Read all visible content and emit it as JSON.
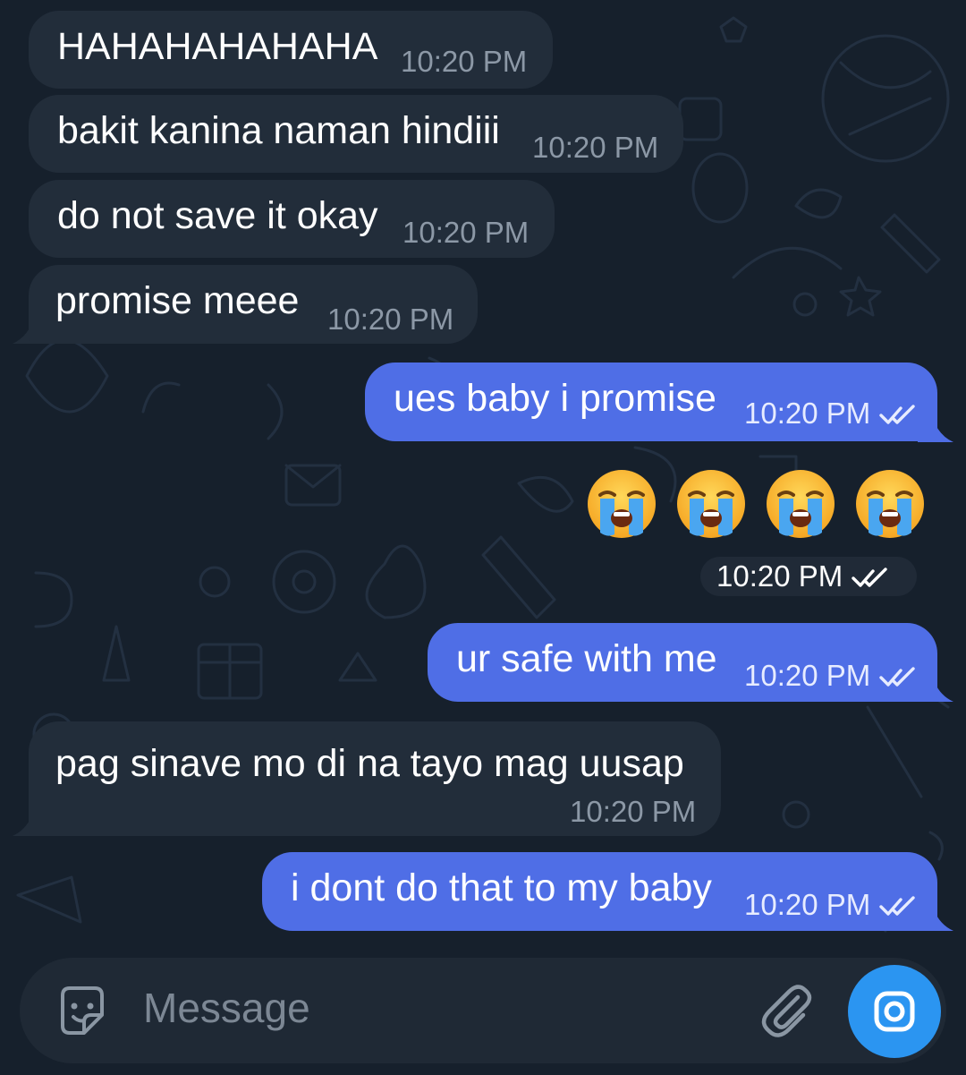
{
  "messages": [
    {
      "direction": "in",
      "text": "HAHAHAHAHAHA",
      "time": "10:20 PM"
    },
    {
      "direction": "in",
      "text": "bakit kanina naman hindiii",
      "time": "10:20 PM"
    },
    {
      "direction": "in",
      "text": "do not save it okay",
      "time": "10:20 PM"
    },
    {
      "direction": "in",
      "text": "promise meee",
      "time": "10:20 PM"
    },
    {
      "direction": "out",
      "text": "ues baby i promise",
      "time": "10:20 PM",
      "status": "read"
    },
    {
      "direction": "out",
      "type": "emoji",
      "emojis": [
        "😭",
        "😭",
        "😭",
        "😭"
      ],
      "time": "10:20 PM",
      "status": "read"
    },
    {
      "direction": "out",
      "text": "ur safe with me",
      "time": "10:20 PM",
      "status": "read"
    },
    {
      "direction": "in",
      "text": "pag sinave mo di na tayo mag uusap",
      "time": "10:20 PM"
    },
    {
      "direction": "out",
      "text": "i dont do that to my baby",
      "time": "10:20 PM",
      "status": "read"
    }
  ],
  "composer": {
    "placeholder": "Message",
    "icons": {
      "left": "sticker-icon",
      "attach": "paperclip-icon",
      "send": "camera-icon"
    }
  },
  "colors": {
    "background": "#16202c",
    "incoming_bubble": "#222d3a",
    "outgoing_bubble": "#4f6ee6",
    "accent": "#2b95f1"
  }
}
